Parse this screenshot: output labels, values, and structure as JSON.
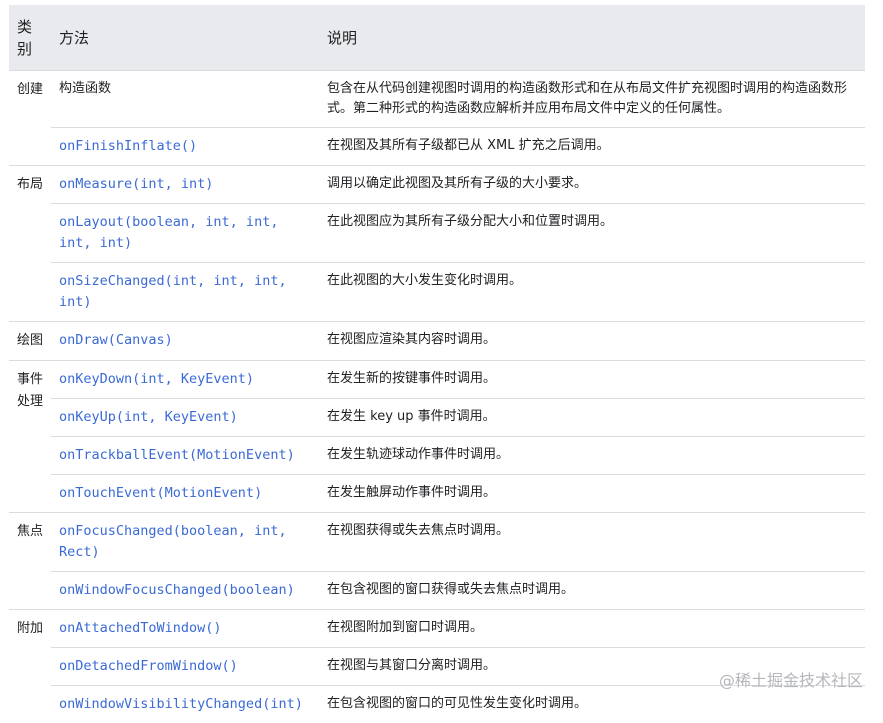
{
  "header": {
    "category": "类别",
    "method": "方法",
    "description": "说明"
  },
  "groups": [
    {
      "category": "创建",
      "rows": [
        {
          "method": "构造函数",
          "code": false,
          "description": "包含在从代码创建视图时调用的构造函数形式和在从布局文件扩充视图时调用的构造函数形式。第二种形式的构造函数应解析并应用布局文件中定义的任何属性。"
        },
        {
          "method": "onFinishInflate()",
          "code": true,
          "description": "在视图及其所有子级都已从 XML 扩充之后调用。"
        }
      ]
    },
    {
      "category": "布局",
      "rows": [
        {
          "method": "onMeasure(int, int)",
          "code": true,
          "description": "调用以确定此视图及其所有子级的大小要求。"
        },
        {
          "method": "onLayout(boolean, int, int, int, int)",
          "code": true,
          "description": "在此视图应为其所有子级分配大小和位置时调用。"
        },
        {
          "method": "onSizeChanged(int, int, int, int)",
          "code": true,
          "description": "在此视图的大小发生变化时调用。"
        }
      ]
    },
    {
      "category": "绘图",
      "rows": [
        {
          "method": "onDraw(Canvas)",
          "code": true,
          "description": "在视图应渲染其内容时调用。"
        }
      ]
    },
    {
      "category": "事件处理",
      "rows": [
        {
          "method": "onKeyDown(int, KeyEvent)",
          "code": true,
          "description": "在发生新的按键事件时调用。"
        },
        {
          "method": "onKeyUp(int, KeyEvent)",
          "code": true,
          "description": "在发生 key up 事件时调用。"
        },
        {
          "method": "onTrackballEvent(MotionEvent)",
          "code": true,
          "description": "在发生轨迹球动作事件时调用。"
        },
        {
          "method": "onTouchEvent(MotionEvent)",
          "code": true,
          "description": "在发生触屏动作事件时调用。"
        }
      ]
    },
    {
      "category": "焦点",
      "rows": [
        {
          "method": "onFocusChanged(boolean, int, Rect)",
          "code": true,
          "description": "在视图获得或失去焦点时调用。"
        },
        {
          "method": "onWindowFocusChanged(boolean)",
          "code": true,
          "description": "在包含视图的窗口获得或失去焦点时调用。"
        }
      ]
    },
    {
      "category": "附加",
      "rows": [
        {
          "method": "onAttachedToWindow()",
          "code": true,
          "description": "在视图附加到窗口时调用。"
        },
        {
          "method": "onDetachedFromWindow()",
          "code": true,
          "description": "在视图与其窗口分离时调用。"
        },
        {
          "method": "onWindowVisibilityChanged(int)",
          "code": true,
          "description": "在包含视图的窗口的可见性发生变化时调用。"
        }
      ]
    }
  ],
  "watermark": "@稀土掘金技术社区"
}
